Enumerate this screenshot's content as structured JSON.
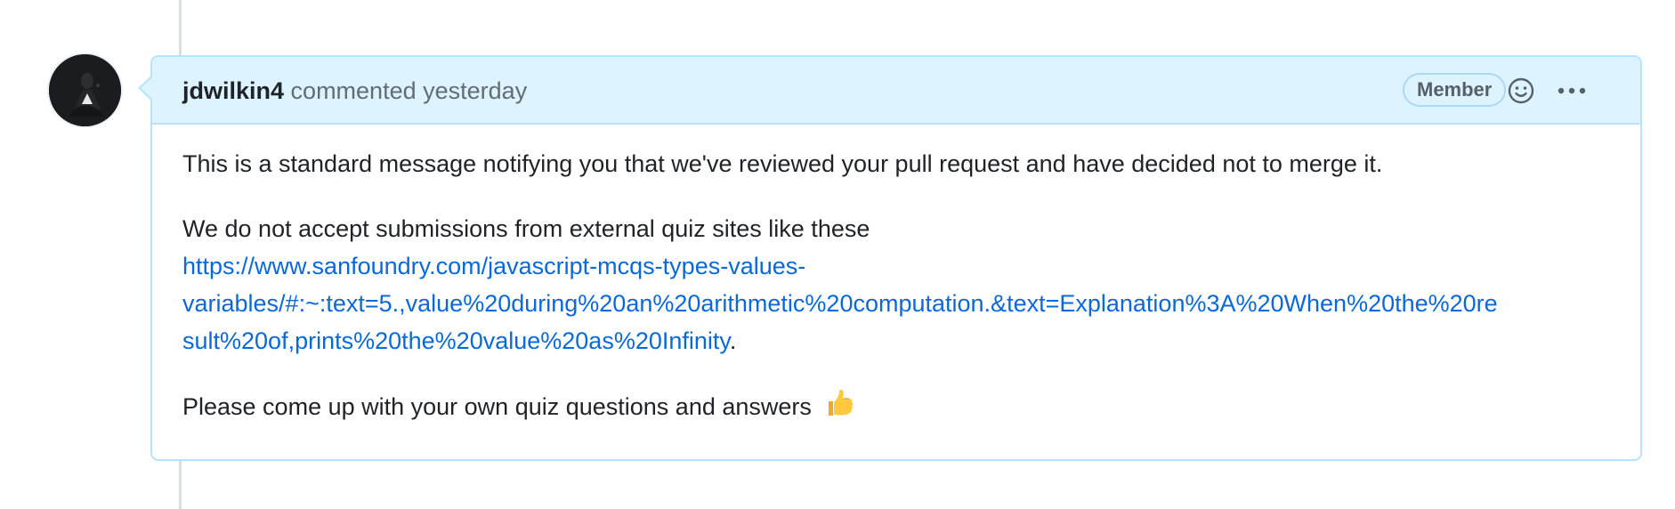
{
  "comment": {
    "author": "jdwilkin4",
    "action": "commented",
    "timestamp": "yesterday",
    "badge": "Member",
    "avatar": "avatar",
    "icons": {
      "reaction": "smiley-icon",
      "menu": "kebab-horizontal-icon"
    },
    "body": {
      "paragraph1": "This is a standard message notifying you that we've reviewed your pull request and have decided not to merge it.",
      "paragraph2_intro": "We do not accept submissions from external quiz sites like these",
      "link_line1": "https://www.sanfoundry.com/javascript-mcqs-types-values-",
      "link_line2": "variables/#:~:text=5.,value%20during%20an%20arithmetic%20computation.&text=Explanation%3A%20When%20the%20re",
      "link_line3": "sult%20of,prints%20the%20value%20as%20Infinity",
      "link_trailing": ".",
      "paragraph3": "Please come up with your own quiz questions and answers",
      "emoji": "thumbsup-icon"
    }
  },
  "colors": {
    "header_bg": "#ddf4ff",
    "border": "#b6e3ff",
    "link": "#0969da",
    "text": "#1f2328",
    "muted": "#636c76"
  }
}
